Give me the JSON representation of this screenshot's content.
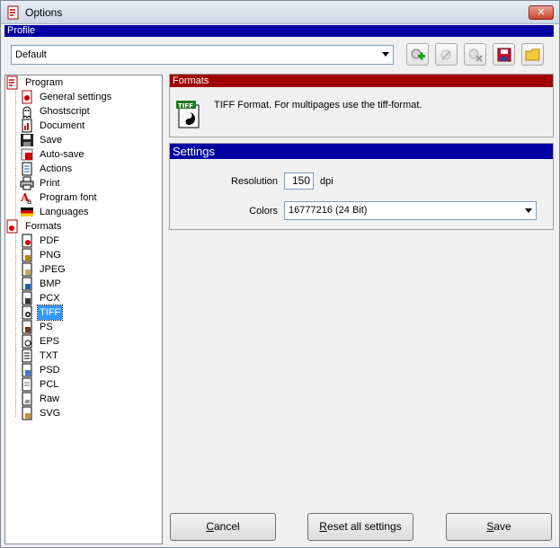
{
  "window": {
    "title": "Options",
    "close_glyph": "✕"
  },
  "profile": {
    "band_label": "Profile",
    "selected": "Default",
    "toolbar_icons": [
      "add-profile-icon",
      "rename-profile-icon",
      "delete-profile-icon",
      "save-profile-icon",
      "open-folder-icon"
    ]
  },
  "tree": {
    "program": {
      "label": "Program",
      "items": [
        {
          "label": "General settings",
          "icon": "general-settings-icon"
        },
        {
          "label": "Ghostscript",
          "icon": "ghostscript-icon"
        },
        {
          "label": "Document",
          "icon": "document-icon"
        },
        {
          "label": "Save",
          "icon": "save-icon"
        },
        {
          "label": "Auto-save",
          "icon": "auto-save-icon"
        },
        {
          "label": "Actions",
          "icon": "actions-icon"
        },
        {
          "label": "Print",
          "icon": "print-icon"
        },
        {
          "label": "Program font",
          "icon": "font-icon"
        },
        {
          "label": "Languages",
          "icon": "language-flag-icon"
        }
      ]
    },
    "formats": {
      "label": "Formats",
      "items": [
        {
          "label": "PDF"
        },
        {
          "label": "PNG"
        },
        {
          "label": "JPEG"
        },
        {
          "label": "BMP"
        },
        {
          "label": "PCX"
        },
        {
          "label": "TIFF"
        },
        {
          "label": "PS"
        },
        {
          "label": "EPS"
        },
        {
          "label": "TXT"
        },
        {
          "label": "PSD"
        },
        {
          "label": "PCL"
        },
        {
          "label": "Raw"
        },
        {
          "label": "SVG"
        }
      ],
      "selected": "TIFF"
    }
  },
  "formats_panel": {
    "band_label": "Formats",
    "icon_label": "TIFF",
    "description": "TIFF Format. For multipages use the tiff-format."
  },
  "settings_panel": {
    "band_label": "Settings",
    "resolution_label": "Resolution",
    "resolution_value": "150",
    "resolution_unit": "dpi",
    "colors_label": "Colors",
    "colors_value": "16777216 (24 Bit)"
  },
  "buttons": {
    "cancel": {
      "mnemonic": "C",
      "rest": "ancel"
    },
    "reset": {
      "mnemonic": "R",
      "rest": "eset all settings"
    },
    "save": {
      "mnemonic": "S",
      "rest": "ave"
    }
  },
  "colors": {
    "band_blue": "#0000a0",
    "band_red": "#a00000",
    "selection": "#3399ff"
  }
}
